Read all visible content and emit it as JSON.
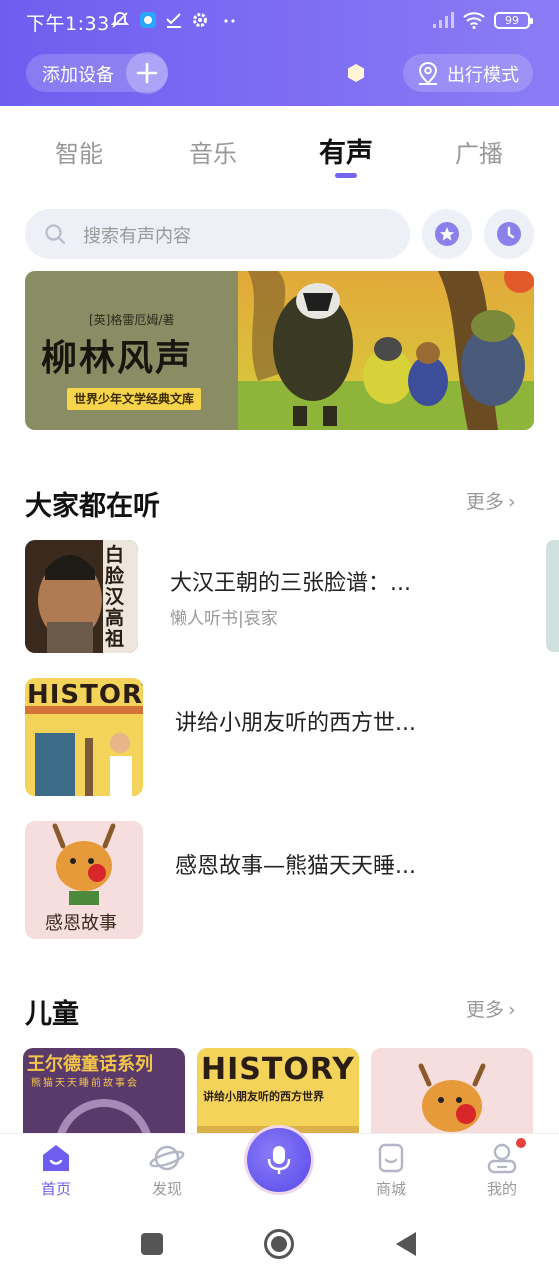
{
  "status_bar": {
    "time": "下午1:33",
    "battery": "99"
  },
  "header": {
    "add_device_label": "添加设备",
    "travel_mode_label": "出行模式"
  },
  "tabs": [
    {
      "label": "智能",
      "active": false
    },
    {
      "label": "音乐",
      "active": false
    },
    {
      "label": "有声",
      "active": true
    },
    {
      "label": "广播",
      "active": false
    }
  ],
  "search": {
    "placeholder": "搜索有声内容"
  },
  "banner": {
    "author": "[英]格雷厄姆/著",
    "title": "柳林风声",
    "series": "世界少年文学经典文库"
  },
  "popular": {
    "title": "大家都在听",
    "more": "更多",
    "items": [
      {
        "title": "大汉王朝的三张脸谱：...",
        "subtitle": "懒人听书|哀家",
        "cover_text": "白脸汉高祖"
      },
      {
        "title": "讲给小朋友听的西方世...",
        "subtitle": "",
        "cover_text": "HISTORY"
      },
      {
        "title": "感恩故事—熊猫天天睡...",
        "subtitle": "",
        "cover_text": "感恩故事"
      }
    ]
  },
  "kids": {
    "title": "儿童",
    "more": "更多",
    "cards": [
      {
        "cover_text": "王尔德童话系列",
        "cover_sub": "熊猫天天睡前故事会"
      },
      {
        "cover_text": "HISTORY",
        "cover_sub": "讲给小朋友听的西方世界"
      },
      {
        "cover_text": "",
        "cover_sub": ""
      }
    ]
  },
  "bottom_nav": [
    {
      "label": "首页",
      "active": true,
      "icon": "home-icon"
    },
    {
      "label": "发现",
      "active": false,
      "icon": "planet-icon"
    },
    {
      "label": "",
      "active": false,
      "icon": "mic-icon"
    },
    {
      "label": "商城",
      "active": false,
      "icon": "shop-icon"
    },
    {
      "label": "我的",
      "active": false,
      "icon": "profile-icon"
    }
  ],
  "colors": {
    "accent": "#6d5ef0",
    "header_start": "#6d5ef0",
    "header_end": "#8b7cf5"
  }
}
